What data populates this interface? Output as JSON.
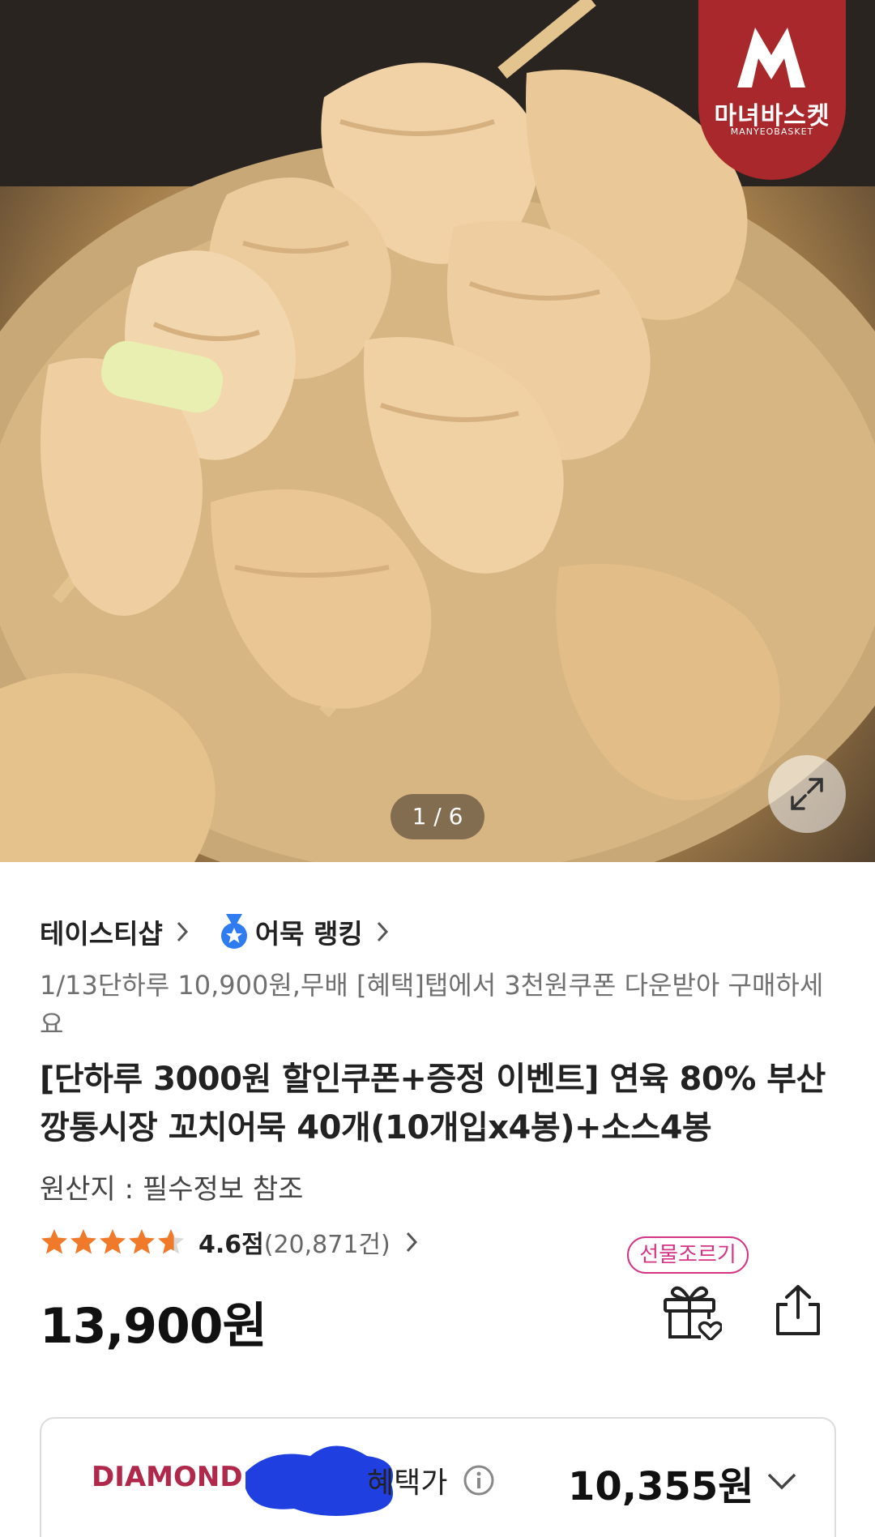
{
  "hero": {
    "brand_name": "마녀바스켓",
    "brand_name_en": "MANYEOBASKET",
    "pager_text": "1 / 6"
  },
  "store": {
    "seller": "테이스티샵",
    "ranking": "어묵 랭킹"
  },
  "promo_text": "1/13단하루 10,900원,무배 [혜택]탭에서 3천원쿠폰 다운받아 구매하세요",
  "product_title": "[단하루 3000원 할인쿠폰+증정 이벤트] 연육 80% 부산깡통시장 꼬치어묵 40개(10개입x4봉)+소스4봉",
  "origin": "원산지 : 필수정보 참조",
  "rating": {
    "score": 4.6,
    "score_text": "4.6점",
    "count_text": "(20,871건)"
  },
  "gift_tag": "선물조르기",
  "price": "13,900원",
  "benefit": {
    "grade": "DIAMOND",
    "label": "혜택가",
    "price": "10,355원"
  },
  "colors": {
    "brand_red": "#a8282b",
    "star": "#f07a2a",
    "gift_pink": "#d63384",
    "grade": "#b0294a",
    "scribble": "#1f3fe0",
    "medal": "#2f7bf2"
  },
  "icons": [
    "chevron-right-icon",
    "medal-icon",
    "star-icon",
    "gift-icon",
    "share-icon",
    "info-icon",
    "chevron-down-icon",
    "expand-icon"
  ]
}
